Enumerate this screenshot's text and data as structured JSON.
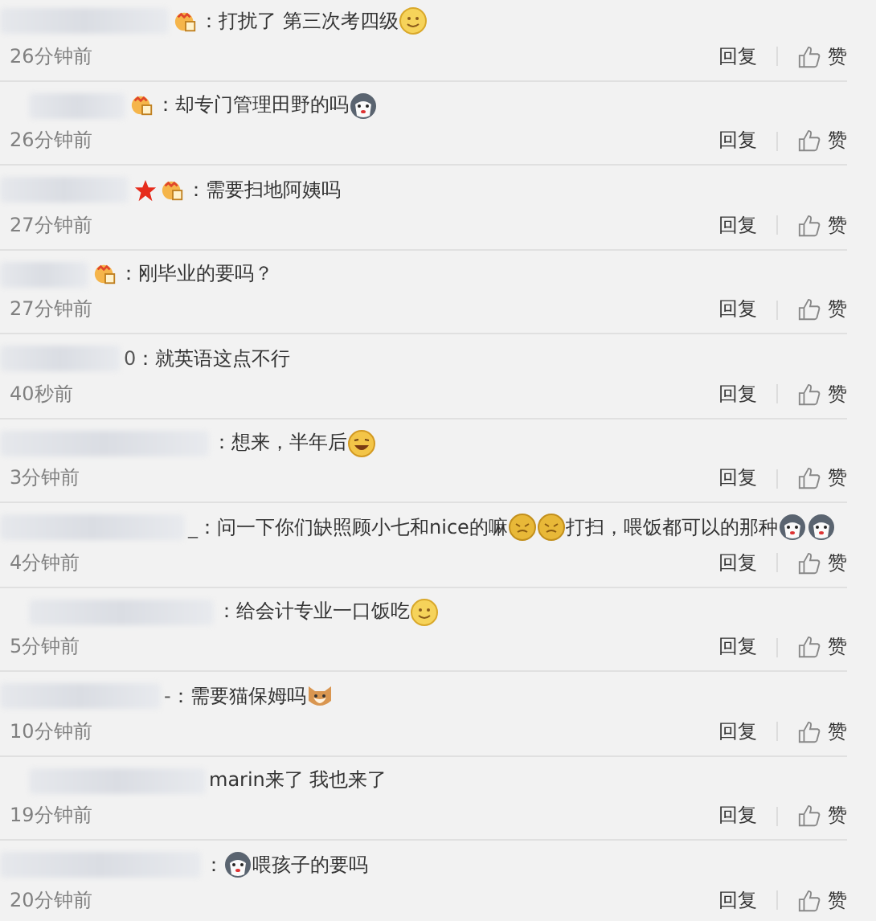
{
  "comments": [
    {
      "badges": [
        {
          "kind": "vip"
        }
      ],
      "parts": [
        {
          "kind": "text",
          "text": "：打扰了 第三次考四级"
        },
        {
          "kind": "smile"
        }
      ],
      "time": "26分钟前",
      "reply": "回复",
      "like": "赞"
    },
    {
      "badges": [
        {
          "kind": "vip"
        }
      ],
      "parts": [
        {
          "kind": "text",
          "text": "：却专门管理田野的吗"
        },
        {
          "kind": "husky"
        }
      ],
      "time": "26分钟前",
      "reply": "回复",
      "like": "赞"
    },
    {
      "badges": [
        {
          "kind": "star"
        },
        {
          "kind": "vip"
        }
      ],
      "parts": [
        {
          "kind": "text",
          "text": "：需要扫地阿姨吗"
        }
      ],
      "time": "27分钟前",
      "reply": "回复",
      "like": "赞"
    },
    {
      "badges": [
        {
          "kind": "vip"
        }
      ],
      "parts": [
        {
          "kind": "text",
          "text": "：刚毕业的要吗？"
        }
      ],
      "time": "27分钟前",
      "reply": "回复",
      "like": "赞"
    },
    {
      "name_tail": "0",
      "parts": [
        {
          "kind": "text",
          "text": "：就英语这点不行"
        }
      ],
      "time": "40秒前",
      "reply": "回复",
      "like": "赞"
    },
    {
      "parts": [
        {
          "kind": "text",
          "text": "：想来，半年后"
        },
        {
          "kind": "laugh"
        }
      ],
      "time": "3分钟前",
      "reply": "回复",
      "like": "赞"
    },
    {
      "name_tail": "_",
      "parts": [
        {
          "kind": "text",
          "text": "：问一下你们缺照顾小七和nice的嘛"
        },
        {
          "kind": "gold"
        },
        {
          "kind": "gold"
        },
        {
          "kind": "text",
          "text": "打扫，喂饭都可以的那种"
        },
        {
          "kind": "husky"
        },
        {
          "kind": "husky"
        }
      ],
      "time": "4分钟前",
      "reply": "回复",
      "like": "赞"
    },
    {
      "parts": [
        {
          "kind": "text",
          "text": "：给会计专业一口饭吃"
        },
        {
          "kind": "smile"
        }
      ],
      "time": "5分钟前",
      "reply": "回复",
      "like": "赞"
    },
    {
      "name_tail": "-",
      "parts": [
        {
          "kind": "text",
          "text": "：需要猫保姆吗"
        },
        {
          "kind": "dog"
        }
      ],
      "time": "10分钟前",
      "reply": "回复",
      "like": "赞"
    },
    {
      "parts": [
        {
          "kind": "text",
          "text": "marin来了 我也来了"
        }
      ],
      "time": "19分钟前",
      "reply": "回复",
      "like": "赞"
    },
    {
      "parts": [
        {
          "kind": "text",
          "text": "："
        },
        {
          "kind": "husky"
        },
        {
          "kind": "text",
          "text": "喂孩子的要吗"
        }
      ],
      "time": "20分钟前",
      "reply": "回复",
      "like": "赞"
    }
  ]
}
